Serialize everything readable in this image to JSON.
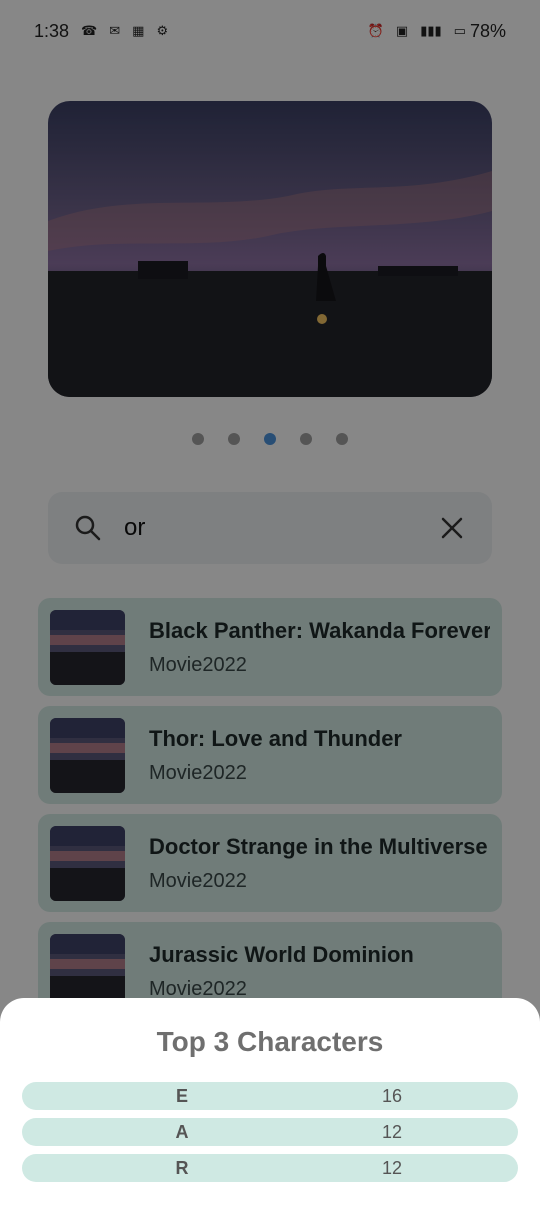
{
  "status": {
    "time": "1:38",
    "battery": "78%",
    "icons": [
      "phone-icon",
      "mail-icon",
      "tata-icon",
      "settings-icon",
      "alarm-icon",
      "volte-icon",
      "signal-icon",
      "battery-icon"
    ]
  },
  "carousel": {
    "dots": 5,
    "active_index": 2
  },
  "search": {
    "query": "or"
  },
  "results": [
    {
      "title": "Black Panther: Wakanda Forever",
      "subtitle": "Movie2022"
    },
    {
      "title": "Thor: Love and Thunder",
      "subtitle": "Movie2022"
    },
    {
      "title": "Doctor Strange in the Multiverse",
      "subtitle": "Movie2022"
    },
    {
      "title": "Jurassic World Dominion",
      "subtitle": "Movie2022"
    }
  ],
  "sheet": {
    "title": "Top 3 Characters",
    "rows": [
      {
        "char": "E",
        "count": "16"
      },
      {
        "char": "A",
        "count": "12"
      },
      {
        "char": "R",
        "count": "12"
      }
    ]
  },
  "colors": {
    "accent": "#4a90d9",
    "card": "#cfe5e0",
    "sheet_row": "#cfe9e3"
  }
}
